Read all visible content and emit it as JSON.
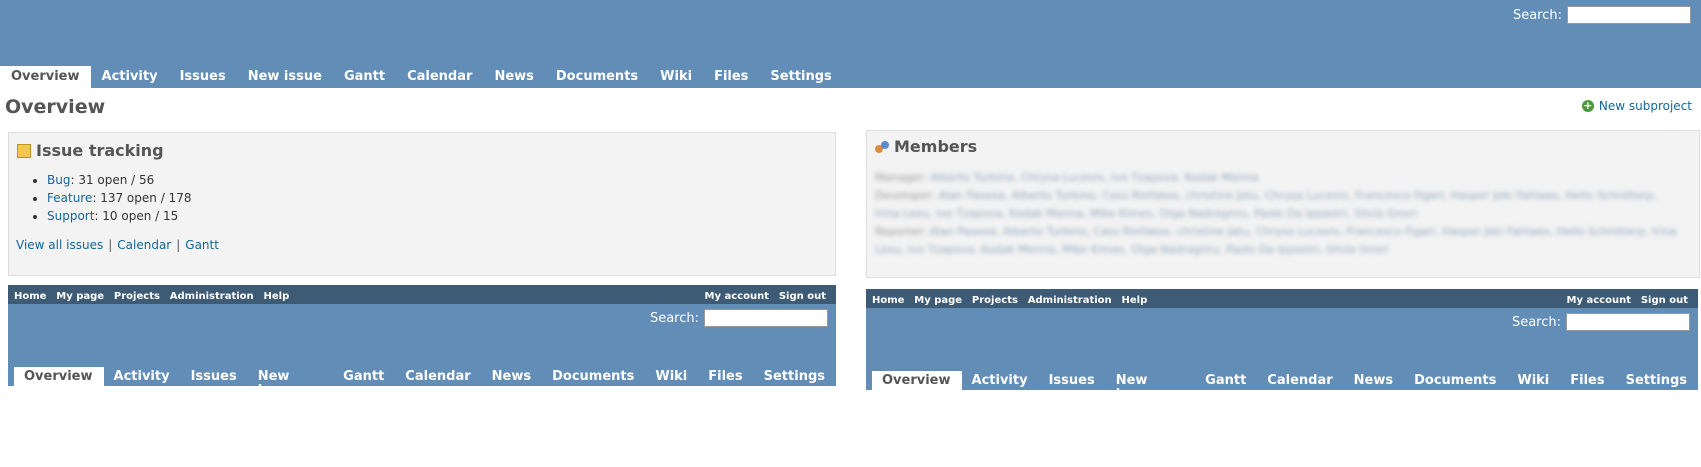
{
  "header": {
    "search_label": "Search:",
    "search_value": "",
    "menu": [
      "Overview",
      "Activity",
      "Issues",
      "New issue",
      "Gantt",
      "Calendar",
      "News",
      "Documents",
      "Wiki",
      "Files",
      "Settings"
    ],
    "selected_tab": "Overview",
    "bg_color": "#628db6"
  },
  "page": {
    "title": "Overview",
    "new_subproject": "New subproject"
  },
  "issue_tracking": {
    "title": "Issue tracking",
    "trackers": [
      {
        "name": "Bug",
        "counts": ": 31 open / 56"
      },
      {
        "name": "Feature",
        "counts": ": 137 open / 178"
      },
      {
        "name": "Support",
        "counts": ": 10 open / 15"
      }
    ],
    "links": [
      "View all issues",
      "Calendar",
      "Gantt"
    ]
  },
  "members": {
    "title": "Members",
    "rows": [
      {
        "role": "Manager:",
        "names": "Alberto Turbino, Chrysa Luceviv, Ivo Tzapova, Kodak Menna"
      },
      {
        "role": "Developer:",
        "names": "Alan Pasexa, Alberto Turbino, Cass Rinfakos, christine Jatu, Chrysa Luceviv, Francesco Figari, Hasper Jeki Fahlaeo, Hello Schnitterp, Irina Lexu, Ivo Tzapova, Kodak Menna, Mike Kimes, Olga Nadragnru, Paolo Da Ippastri, Silvia Gnori"
      },
      {
        "role": "Reporter:",
        "names": "Alan Pasexa, Alberto Turbino, Cass Rinfakos, christine Jatu, Chrysa Luceviv, Francesco Figari, Hasper Jeki Fahlaeo, Hello Schnitterp, Irina Lexu, Ivo Tzapova, Kodak Menna, Mike Kimes, Olga Nadragnru, Paolo Da Ippastri, Silvia Gnori"
      }
    ]
  },
  "nested_frame": {
    "top_left": [
      "Home",
      "My page",
      "Projects",
      "Administration",
      "Help"
    ],
    "top_right": [
      "My account",
      "Sign out"
    ],
    "search_label": "Search:",
    "menu": [
      "Overview",
      "Activity",
      "Issues",
      "New issue",
      "Gantt",
      "Calendar",
      "News",
      "Documents",
      "Wiki",
      "Files",
      "Settings"
    ]
  }
}
